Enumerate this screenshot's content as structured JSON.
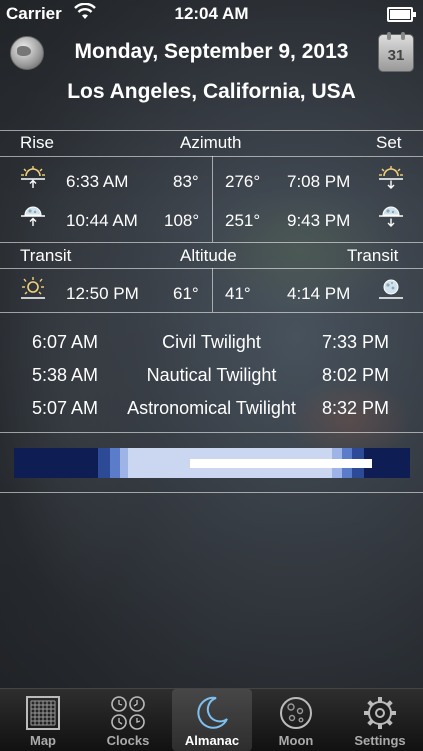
{
  "status_bar": {
    "carrier": "Carrier",
    "time": "12:04 AM"
  },
  "header": {
    "date": "Monday, September 9, 2013",
    "location": "Los Angeles, California, USA",
    "calendar_day": "31"
  },
  "rise_set": {
    "headers": {
      "rise": "Rise",
      "azimuth": "Azimuth",
      "set": "Set"
    },
    "sun": {
      "rise_time": "6:33 AM",
      "rise_az": "83°",
      "set_az": "276°",
      "set_time": "7:08 PM"
    },
    "moon": {
      "rise_time": "10:44 AM",
      "rise_az": "108°",
      "set_az": "251°",
      "set_time": "9:43 PM"
    }
  },
  "transit": {
    "headers": {
      "left": "Transit",
      "altitude": "Altitude",
      "right": "Transit"
    },
    "sun_time": "12:50 PM",
    "sun_alt": "61°",
    "moon_alt": "41°",
    "moon_time": "4:14 PM"
  },
  "twilight": [
    {
      "start": "6:07 AM",
      "name": "Civil Twilight",
      "end": "7:33 PM"
    },
    {
      "start": "5:38 AM",
      "name": "Nautical Twilight",
      "end": "8:02 PM"
    },
    {
      "start": "5:07 AM",
      "name": "Astronomical Twilight",
      "end": "8:32 PM"
    }
  ],
  "colors": {
    "night": "#0e1e55",
    "astro": "#2c4a96",
    "nautical": "#5b7cc8",
    "civil": "#9fb4e6",
    "day": "#cbd6f0"
  },
  "tabs": [
    {
      "label": "Map"
    },
    {
      "label": "Clocks"
    },
    {
      "label": "Almanac"
    },
    {
      "label": "Moon"
    },
    {
      "label": "Settings"
    }
  ]
}
